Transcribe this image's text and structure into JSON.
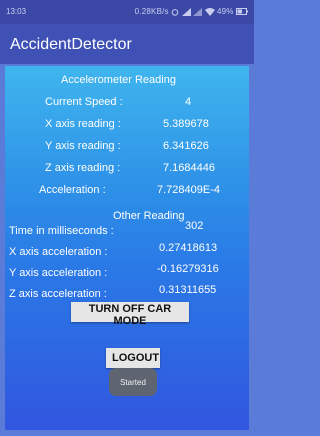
{
  "status_bar": {
    "time": "13:03",
    "network_speed": "0.28KB/s",
    "battery": "49%"
  },
  "app_bar": {
    "title": "AccidentDetector"
  },
  "accelerometer": {
    "heading": "Accelerometer Reading",
    "rows": [
      {
        "label": "Current Speed :",
        "value": "4"
      },
      {
        "label": "X axis reading :",
        "value": "5.389678"
      },
      {
        "label": "Y axis reading :",
        "value": "6.341626"
      },
      {
        "label": "Z axis reading :",
        "value": "7.1684446"
      },
      {
        "label": "Acceleration :",
        "value": "7.728409E-4"
      }
    ]
  },
  "other": {
    "heading": "Other Reading",
    "rows": [
      {
        "label": "Time in milliseconds :",
        "value": "302"
      },
      {
        "label": "X axis acceleration :",
        "value": "0.27418613"
      },
      {
        "label": "Y axis acceleration :",
        "value": "-0.16279316"
      },
      {
        "label": "Z axis acceleration :",
        "value": "0.31311655"
      }
    ]
  },
  "buttons": {
    "car_mode": "TURN OFF CAR MODE",
    "logout": "LOGOUT"
  },
  "toast": {
    "text": "Started"
  },
  "colors": {
    "app_bar": "#3f51b5",
    "status_bar": "#3b48a6",
    "content_top": "#3fb5ee",
    "content_bottom": "#3156df"
  }
}
